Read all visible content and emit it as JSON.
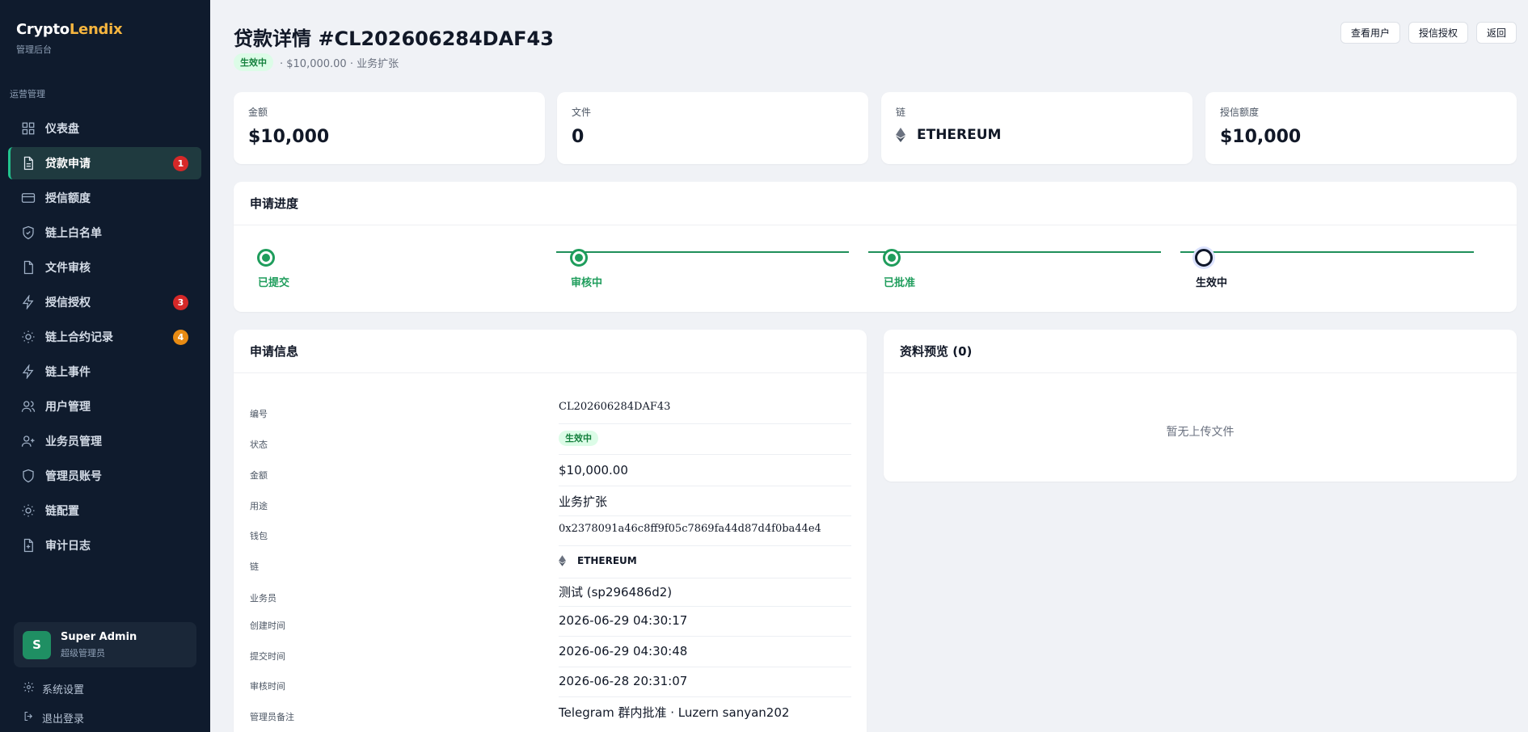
{
  "brand": {
    "name_a": "Crypto",
    "name_b": "Lendix",
    "subtitle": "管理后台"
  },
  "sidebar": {
    "section_label": "运营管理",
    "items": [
      {
        "label": "仪表盘",
        "icon": "grid-icon"
      },
      {
        "label": "贷款申请",
        "icon": "document-icon",
        "badge": "1",
        "badge_color": "#d62828",
        "active": true
      },
      {
        "label": "授信额度",
        "icon": "card-icon"
      },
      {
        "label": "链上白名单",
        "icon": "shield-check-icon"
      },
      {
        "label": "文件审核",
        "icon": "file-icon"
      },
      {
        "label": "授信授权",
        "icon": "lightning-icon",
        "badge": "3",
        "badge_color": "#d62828"
      },
      {
        "label": "链上合约记录",
        "icon": "sun-icon",
        "badge": "4",
        "badge_color": "#e88b13"
      },
      {
        "label": "链上事件",
        "icon": "lightning-icon"
      },
      {
        "label": "用户管理",
        "icon": "users-icon"
      },
      {
        "label": "业务员管理",
        "icon": "user-plus-icon"
      },
      {
        "label": "管理员账号",
        "icon": "shield-icon"
      },
      {
        "label": "链配置",
        "icon": "sun-icon"
      },
      {
        "label": "审计日志",
        "icon": "file-plus-icon"
      }
    ],
    "user": {
      "initial": "S",
      "name": "Super Admin",
      "role": "超级管理员"
    },
    "settings_label": "系统设置",
    "logout_label": "退出登录"
  },
  "header": {
    "title": "贷款详情 #CL202606284DAF43",
    "status_badge": "生效中",
    "subline": "· $10,000.00 · 业务扩张",
    "actions": {
      "view_user": "查看用户",
      "credit_auth": "授信授权",
      "back": "返回"
    }
  },
  "stats": {
    "amount": {
      "label": "金额",
      "value": "$10,000"
    },
    "files": {
      "label": "文件",
      "value": "0"
    },
    "chain": {
      "label": "链",
      "value": "ETHEREUM"
    },
    "credit": {
      "label": "授信额度",
      "value": "$10,000"
    }
  },
  "progress": {
    "title": "申请进度",
    "steps": [
      {
        "label": "已提交",
        "state": "done"
      },
      {
        "label": "审核中",
        "state": "done"
      },
      {
        "label": "已批准",
        "state": "done"
      },
      {
        "label": "生效中",
        "state": "current"
      }
    ]
  },
  "info": {
    "title": "申请信息",
    "rows": {
      "id": {
        "key": "编号",
        "value": "CL202606284DAF43"
      },
      "status": {
        "key": "状态",
        "value": "生效中"
      },
      "amount": {
        "key": "金额",
        "value": "$10,000.00"
      },
      "purpose": {
        "key": "用途",
        "value": "业务扩张"
      },
      "wallet": {
        "key": "钱包",
        "value": "0x2378091a46c8ff9f05c7869fa44d87d4f0ba44e4"
      },
      "chain": {
        "key": "链",
        "value": "ETHEREUM"
      },
      "salesperson": {
        "key": "业务员",
        "value": "测试 (sp296486d2)"
      },
      "created": {
        "key": "创建时间",
        "value": "2026-06-29 04:30:17"
      },
      "submitted": {
        "key": "提交时间",
        "value": "2026-06-29 04:30:48"
      },
      "reviewed": {
        "key": "审核时间",
        "value": "2026-06-28 20:31:07"
      },
      "note": {
        "key": "管理员备注",
        "value": "Telegram 群内批准 · Luzern sanyan202"
      }
    }
  },
  "preview": {
    "title": "资料预览 (0)",
    "empty_text": "暂无上传文件"
  },
  "colors": {
    "sidebar_bg": "#0f1b2d",
    "accent_green": "#1f9d5c",
    "brand_gold": "#f5b53f"
  }
}
